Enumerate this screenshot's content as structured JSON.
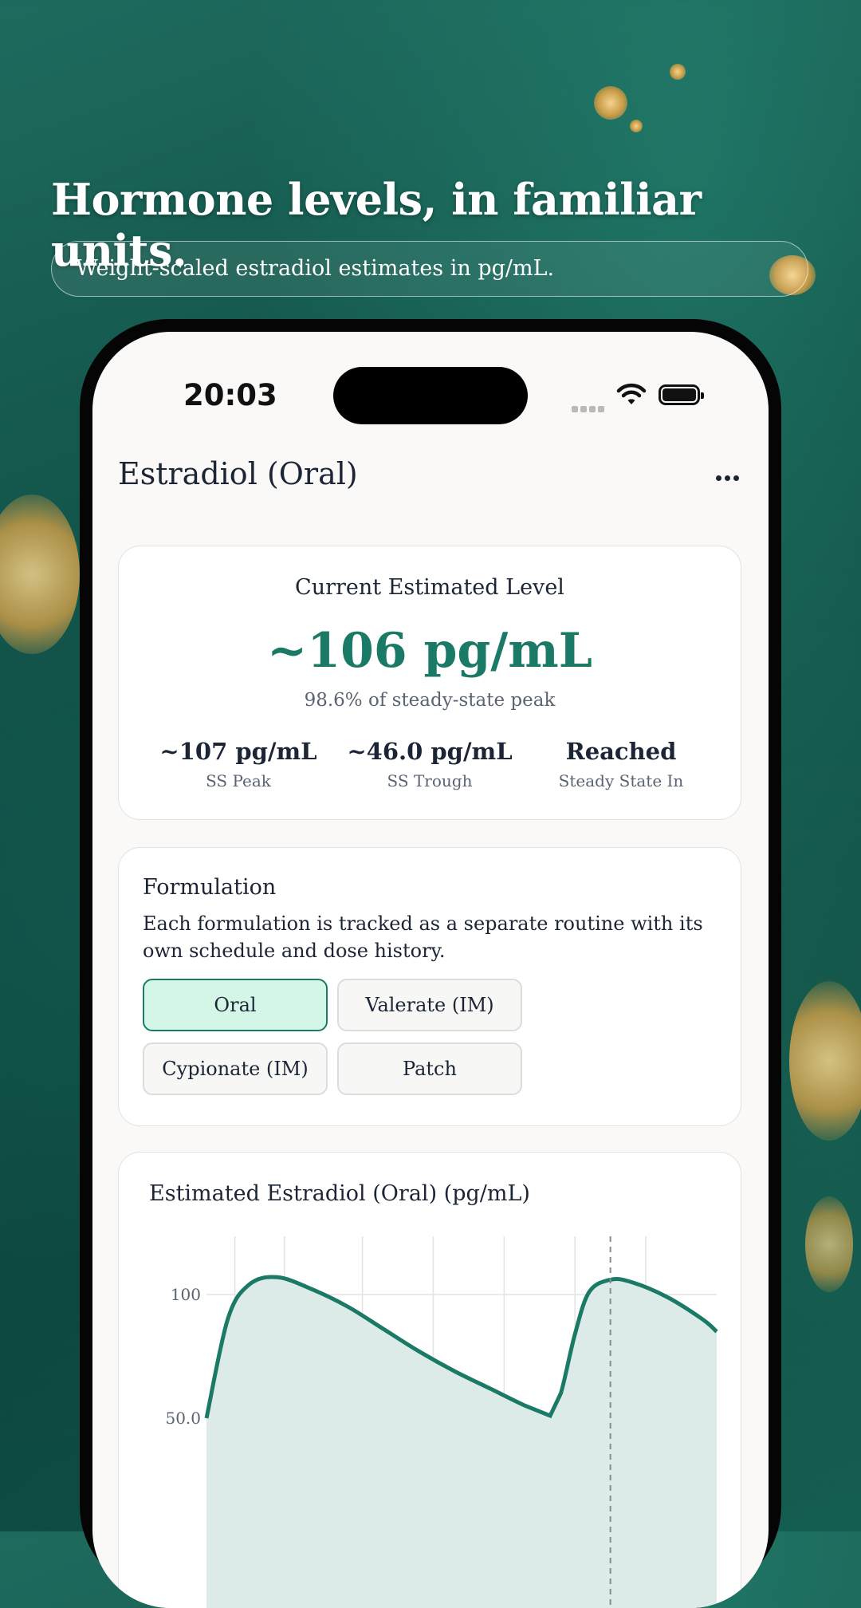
{
  "headline": "Hormone levels, in familiar units.",
  "subheadline": "Weight-scaled estradiol estimates in pg/mL.",
  "status_bar": {
    "time": "20:03"
  },
  "nav": {
    "title": "Estradiol (Oral)",
    "more_icon": "ellipsis-icon"
  },
  "current": {
    "label": "Current Estimated Level",
    "value": "~106 pg/mL",
    "subtext": "98.6% of steady-state peak",
    "stats": [
      {
        "value": "~107 pg/mL",
        "label": "SS Peak"
      },
      {
        "value": "~46.0 pg/mL",
        "label": "SS Trough"
      },
      {
        "value": "Reached",
        "label": "Steady State In"
      }
    ]
  },
  "formulation": {
    "title": "Formulation",
    "description": "Each formulation is tracked as a separate routine with its own schedule and dose history.",
    "options": [
      "Oral",
      "Valerate (IM)",
      "Cypionate (IM)",
      "Patch"
    ],
    "selected": "Oral"
  },
  "chart_data": {
    "type": "area",
    "title": "Estimated Estradiol (Oral) (pg/mL)",
    "yticks": [
      "100",
      "50.0"
    ],
    "series": [
      {
        "x": [
          0,
          0.3,
          0.6,
          1.0,
          1.5,
          2.0,
          2.5,
          3.0,
          3.5,
          4.0,
          4.5,
          4.85,
          5.0,
          5.2,
          5.4,
          5.7,
          6.0,
          6.5,
          7.0,
          7.2
        ],
        "values": [
          50,
          90,
          104,
          107,
          102,
          95,
          86,
          77,
          69,
          62,
          55,
          51,
          60,
          84,
          101,
          106,
          105,
          99,
          90,
          85
        ]
      }
    ],
    "current_marker_x": 5.7,
    "colors": {
      "line": "#1a7a66",
      "fill": "#dcebe8",
      "grid": "#e3e3e3",
      "marker": "#8a8a8a"
    }
  }
}
